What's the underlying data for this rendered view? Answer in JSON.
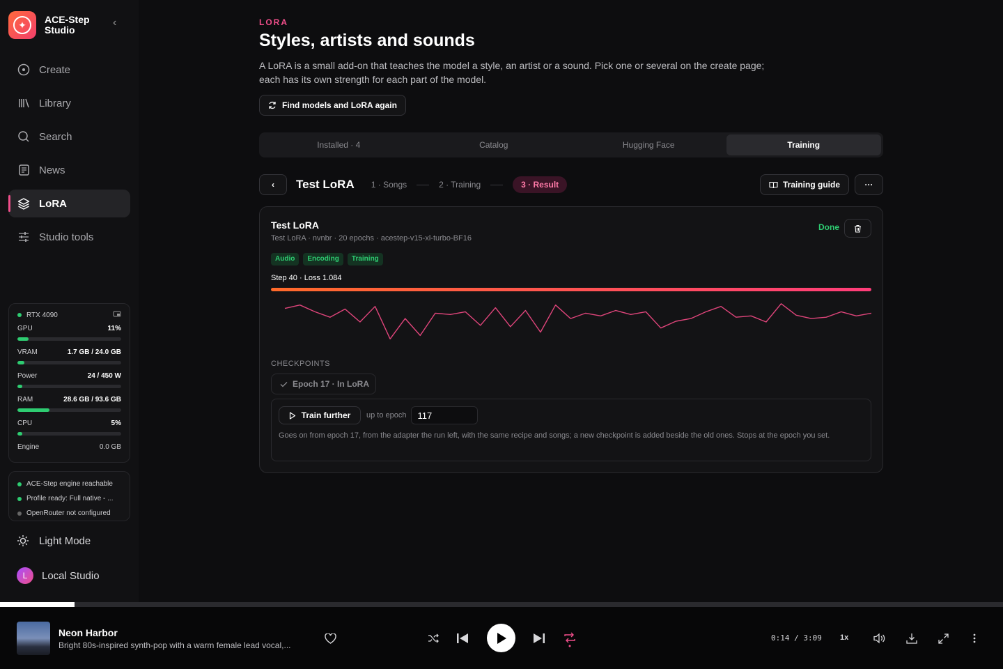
{
  "app": {
    "name_line1": "ACE-Step",
    "name_line2": "Studio"
  },
  "nav": [
    {
      "label": "Create",
      "icon": "disc-icon"
    },
    {
      "label": "Library",
      "icon": "library-icon"
    },
    {
      "label": "Search",
      "icon": "search-icon"
    },
    {
      "label": "News",
      "icon": "news-icon"
    },
    {
      "label": "LoRA",
      "icon": "layers-icon",
      "active": true
    },
    {
      "label": "Studio tools",
      "icon": "sliders-icon"
    }
  ],
  "hardware": {
    "device": "RTX 4090",
    "metrics": [
      {
        "label": "GPU",
        "value": "11%",
        "fill": 0.11
      },
      {
        "label": "VRAM",
        "value": "1.7 GB / 24.0 GB",
        "fill": 0.07
      },
      {
        "label": "Power",
        "value": "24 / 450 W",
        "fill": 0.05
      },
      {
        "label": "RAM",
        "value": "28.6 GB / 93.6 GB",
        "fill": 0.31
      },
      {
        "label": "CPU",
        "value": "5%",
        "fill": 0.05
      }
    ],
    "engine_label": "Engine",
    "engine_value": "0.0 GB"
  },
  "status": [
    {
      "text": "ACE-Step engine reachable",
      "ok": true
    },
    {
      "text": "Profile ready: Full native - ...",
      "ok": true
    },
    {
      "text": "OpenRouter not configured",
      "ok": false
    }
  ],
  "footer": {
    "theme_label": "Light Mode",
    "profile_initial": "L",
    "profile_name": "Local Studio"
  },
  "page": {
    "eyebrow": "LORA",
    "title": "Styles, artists and sounds",
    "description": "A LoRA is a small add-on that teaches the model a style, an artist or a sound. Pick one or several on the create page; each has its own strength for each part of the model.",
    "refresh_label": "Find models and LoRA again"
  },
  "tabs": [
    {
      "label": "Installed · 4"
    },
    {
      "label": "Catalog"
    },
    {
      "label": "Hugging Face"
    },
    {
      "label": "Training",
      "active": true
    }
  ],
  "wizard": {
    "title": "Test LoRA",
    "steps": [
      "1 · Songs",
      "2 · Training",
      "3 · Result"
    ],
    "guide_label": "Training guide"
  },
  "result": {
    "title": "Test LoRA",
    "subtitle": "Test LoRA · nvnbr · 20 epochs · acestep-v15-xl-turbo-BF16",
    "state": "Done",
    "chips": [
      "Audio",
      "Encoding",
      "Training"
    ],
    "step_loss": "Step 40 · Loss 1.084",
    "progress": 1.0,
    "checkpoints_label": "CHECKPOINTS",
    "checkpoint": "Epoch 17 · In LoRA",
    "train_further_label": "Train further",
    "up_to_label": "up to epoch",
    "epoch_value": "117",
    "further_desc": "Goes on from epoch 17, from the adapter the run left, with the same recipe and songs; a new checkpoint is added beside the old ones. Stops at the epoch you set."
  },
  "chart_data": {
    "type": "line",
    "x": [
      1,
      2,
      3,
      4,
      5,
      6,
      7,
      8,
      9,
      10,
      11,
      12,
      13,
      14,
      15,
      16,
      17,
      18,
      19,
      20,
      21,
      22,
      23,
      24,
      25,
      26,
      27,
      28,
      29,
      30,
      31,
      32,
      33,
      34,
      35,
      36,
      37,
      38,
      39,
      40
    ],
    "series": [
      {
        "values": [
          1.15,
          1.2,
          1.1,
          1.02,
          1.14,
          0.95,
          1.18,
          0.7,
          1.0,
          0.75,
          1.08,
          1.06,
          1.1,
          0.9,
          1.16,
          0.88,
          1.12,
          0.8,
          1.2,
          1.0,
          1.08,
          1.04,
          1.12,
          1.06,
          1.1,
          0.86,
          0.96,
          1.0,
          1.1,
          1.18,
          1.02,
          1.04,
          0.95,
          1.22,
          1.05,
          1.0,
          1.02,
          1.1,
          1.04,
          1.08
        ]
      }
    ],
    "ylim": [
      0.6,
      1.3
    ],
    "color": "#e0457b"
  },
  "player": {
    "title": "Neon Harbor",
    "subtitle": "Bright 80s-inspired synth-pop with a warm female lead vocal,...",
    "time": "0:14 / 3:09",
    "rate": "1x",
    "position": 0.074
  }
}
